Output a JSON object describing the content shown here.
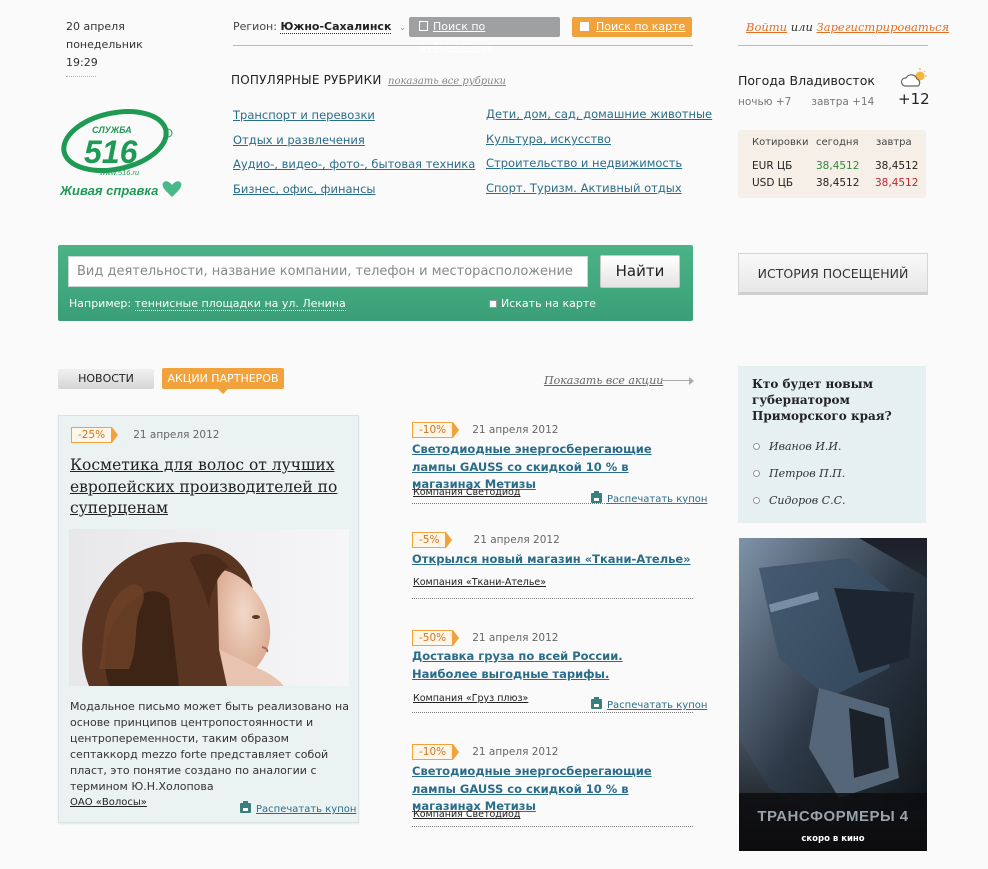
{
  "header": {
    "date": "20 апреля",
    "weekday": "понедельник",
    "time": "19:29",
    "logo_service": "СЛУЖБА",
    "logo_number": "516",
    "logo_site": "www.516.ru",
    "logo_tagline": "Живая справка",
    "region_label": "Регион:",
    "region_value": "Южно-Сахалинск",
    "btn_rubricator": "Поиск по рубрикатору",
    "btn_map": "Поиск по карте",
    "login": "Войти",
    "or": "или",
    "register": "Зарегистрироваться"
  },
  "popular": {
    "title": "Популярные рубрики",
    "show_all": "показать все рубрики",
    "left": [
      "Транспорт и перевозки",
      "Отдых и развлечения",
      "Аудио-, видео-, фото-, бытовая техника",
      "Бизнес, офис, финансы"
    ],
    "right": [
      "Дети, дом, сад, домашние животные",
      "Культура, искусство",
      "Строительство и недвижимость",
      "Спорт. Туризм. Активный отдых"
    ]
  },
  "weather": {
    "title": "Погода Владивосток",
    "night": "ночью +7",
    "tomorrow": "завтра +14",
    "temp": "+12"
  },
  "currency": {
    "h_label": "Котировки",
    "h_today": "сегодня",
    "h_tomorrow": "завтра",
    "rows": [
      {
        "name": "EUR ЦБ",
        "today": "38,4512",
        "tomorrow": "38,4512"
      },
      {
        "name": "USD ЦБ",
        "today": "38,4512",
        "tomorrow": "38,4512"
      }
    ],
    "up_color": "#2f8a3a",
    "down_color": "#c0262d"
  },
  "search": {
    "placeholder": "Вид деятельности, название компании, телефон и месторасположение",
    "button": "Найти",
    "example_label": "Например:",
    "example_value": "теннисные площадки на ул. Ленина",
    "map_check": "Искать на карте"
  },
  "history": {
    "label": "История посещений"
  },
  "tabs": {
    "news": "Новости",
    "actions": "Акции партнеров",
    "show_all": "Показать все акции"
  },
  "featured": {
    "badge": "-25%",
    "date": "21 апреля 2012",
    "title": "Косметика для волос от лучших европейских производителей по суперценам",
    "text": "Модальное письмо может быть реализовано на основе принципов центропостоянности и центропеременности, таким образом септаккорд mezzo forte представляет собой пласт, это понятие создано по аналогии с термином Ю.Н.Холопова",
    "company": "ОАО «Волосы»",
    "print": "Распечатать купон"
  },
  "items": [
    {
      "badge": "-10%",
      "date": "21 апреля 2012",
      "title": "Светодиодные энергосберегающие лампы GAUSS со скидкой 10 % в магазинах Метизы",
      "company": "Компания Светодиод",
      "print": "Распечатать купон"
    },
    {
      "badge": "-5%",
      "date": "21 апреля 2012",
      "title": "Открылся новый магазин «Ткани-Ателье»",
      "company": "Компания «Ткани-Ателье»",
      "print": ""
    },
    {
      "badge": "-50%",
      "date": "21 апреля 2012",
      "title": "Доставка груза по всей России. Наиболее выгодные тарифы.",
      "company": "Компания «Груз плюз»",
      "print": "Распечатать купон"
    },
    {
      "badge": "-10%",
      "date": "21 апреля 2012",
      "title": "Светодиодные энергосберегающие лампы GAUSS со скидкой 10 % в магазинах Метизы",
      "company": "Компания Светодиод",
      "print": ""
    }
  ],
  "poll": {
    "question": "Кто будет новым губернатором Приморского края?",
    "options": [
      "Иванов И.И.",
      "Петров П.П.",
      "Сидоров С.С."
    ]
  },
  "banner": {
    "title": "ТРАНСФОРМЕРЫ 4",
    "subtitle": "скоро в кино"
  }
}
